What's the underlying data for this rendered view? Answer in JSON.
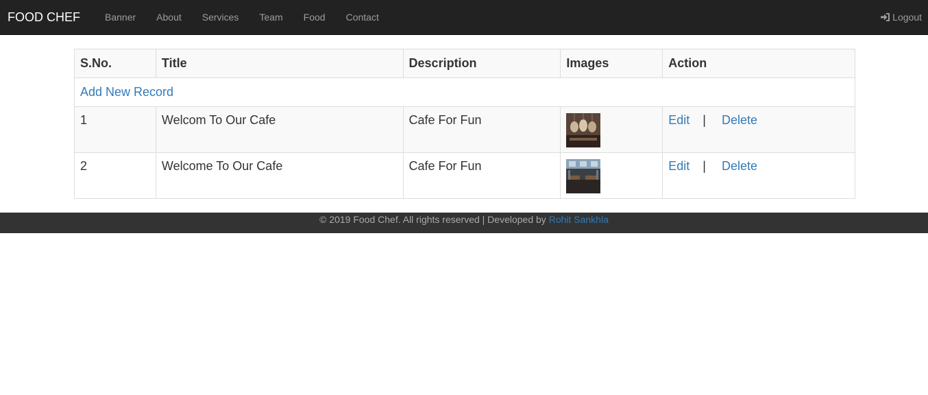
{
  "navbar": {
    "brand": "FOOD CHEF",
    "items": [
      {
        "label": "Banner"
      },
      {
        "label": "About"
      },
      {
        "label": "Services"
      },
      {
        "label": "Team"
      },
      {
        "label": "Food"
      },
      {
        "label": "Contact"
      }
    ],
    "logout_label": "Logout",
    "logout_icon": "log-in-icon"
  },
  "table": {
    "headers": [
      "S.No.",
      "Title",
      "Description",
      "Images",
      "Action"
    ],
    "add_label": "Add New Record",
    "rows": [
      {
        "sno": "1",
        "title": "Welcom To Our Cafe",
        "description": "Cafe For Fun",
        "image": "cafe-thumbnail-1",
        "edit": "Edit",
        "sep": "|",
        "delete": "Delete"
      },
      {
        "sno": "2",
        "title": "Welcome To Our Cafe",
        "description": "Cafe For Fun",
        "image": "cafe-thumbnail-2",
        "edit": "Edit",
        "sep": "|",
        "delete": "Delete"
      }
    ]
  },
  "footer": {
    "text": "© 2019 Food Chef. All rights reserved | Developed by",
    "author": "Rohit Sankhla"
  },
  "colors": {
    "navbar_bg": "#222222",
    "nav_text": "#9d9d9d",
    "link": "#337ab7",
    "footer_bg": "#333333"
  }
}
